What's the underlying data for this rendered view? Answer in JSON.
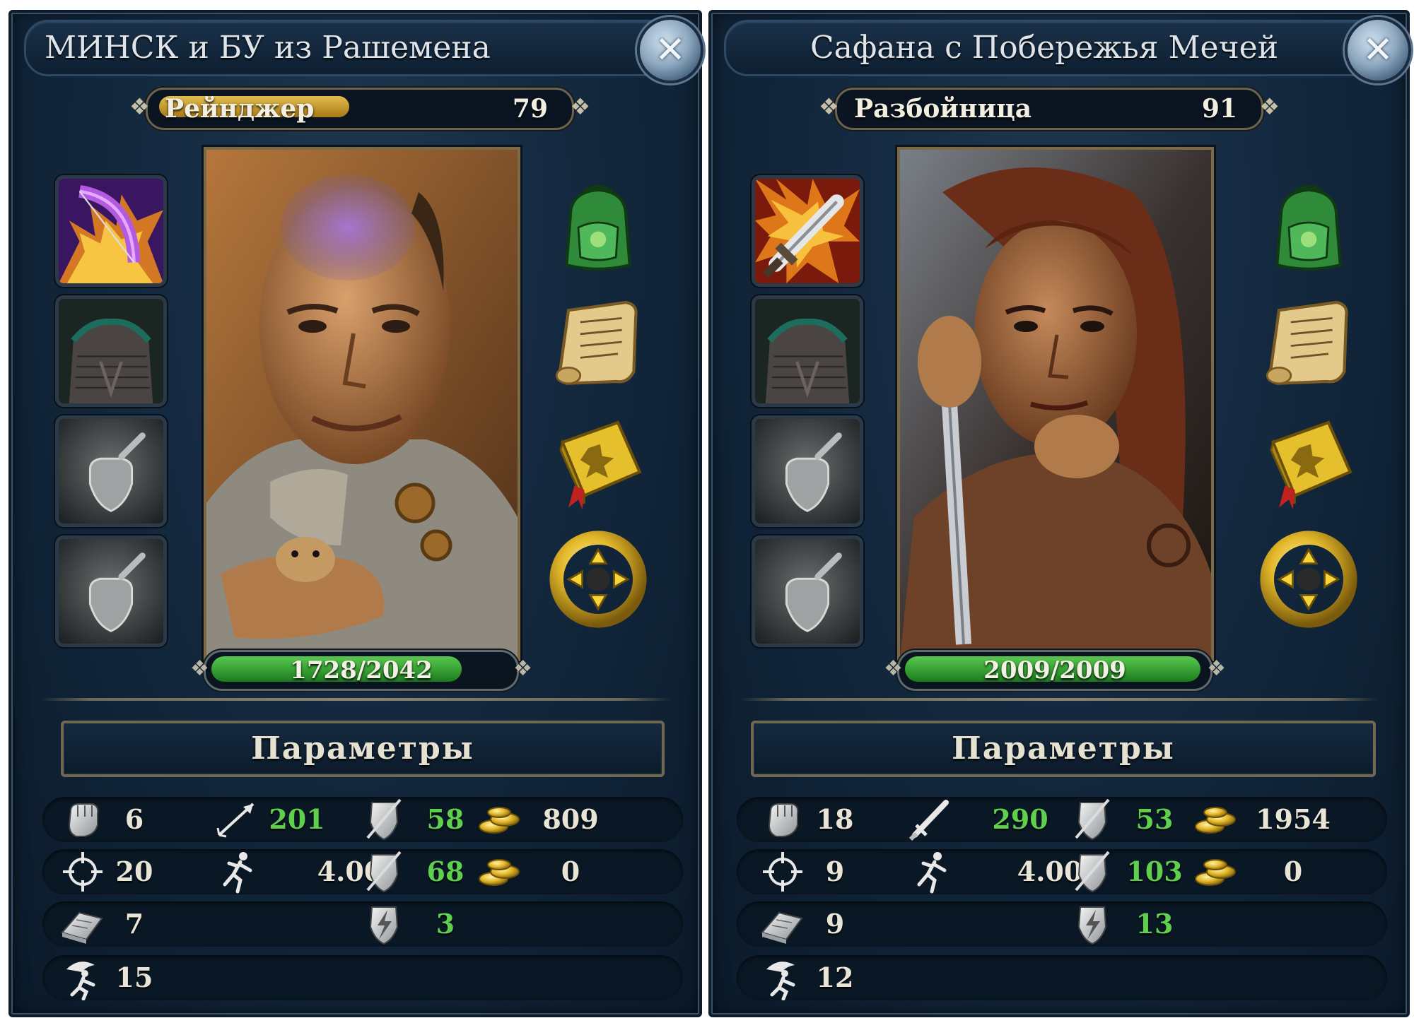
{
  "colors": {
    "panel_bg": "#12263b",
    "title_text": "#dfe4ea",
    "xp_bar": "#c99a2e",
    "hp_bar": "#3fa93a",
    "value_white": "#e8e4d6",
    "value_green": "#5fd04d",
    "frame_gold": "#6d6a50"
  },
  "characters": [
    {
      "name": "МИНСК и БУ из Рашемена",
      "class_name": "Рейнджер",
      "level": "79",
      "xp_fraction": 0.48,
      "hp_text": "1728/2042",
      "hp_fraction": 0.846,
      "params_title": "Параметры",
      "equipment_slots": [
        "flaming-bow-icon",
        "chainmail-armor-icon",
        "empty-shield-slot-icon",
        "empty-shield-slot-icon"
      ],
      "menu_icons": [
        "backpack-icon",
        "scroll-icon",
        "spellbook-icon",
        "talents-wheel-icon"
      ],
      "stats": {
        "strength": "6",
        "accuracy": "20",
        "intellect": "7",
        "stealth": "15",
        "attack": "201",
        "attack_icon": "arrow-icon",
        "speed": "4.00",
        "armor_1": "58",
        "armor_2": "68",
        "armor_3": "3",
        "gold_1": "809",
        "gold_2": "0"
      }
    },
    {
      "name": "Сафана с Побережья Мечей",
      "class_name": "Разбойница",
      "level": "91",
      "xp_fraction": 0.0,
      "hp_text": "2009/2009",
      "hp_fraction": 1.0,
      "params_title": "Параметры",
      "equipment_slots": [
        "flaming-sword-icon",
        "chainmail-armor-icon",
        "empty-shield-slot-icon",
        "empty-shield-slot-icon"
      ],
      "menu_icons": [
        "backpack-icon",
        "scroll-icon",
        "spellbook-icon",
        "talents-wheel-icon"
      ],
      "stats": {
        "strength": "18",
        "accuracy": "9",
        "intellect": "9",
        "stealth": "12",
        "attack": "290",
        "attack_icon": "sword-icon",
        "speed": "4.00",
        "armor_1": "53",
        "armor_2": "103",
        "armor_3": "13",
        "gold_1": "1954",
        "gold_2": "0"
      }
    }
  ]
}
